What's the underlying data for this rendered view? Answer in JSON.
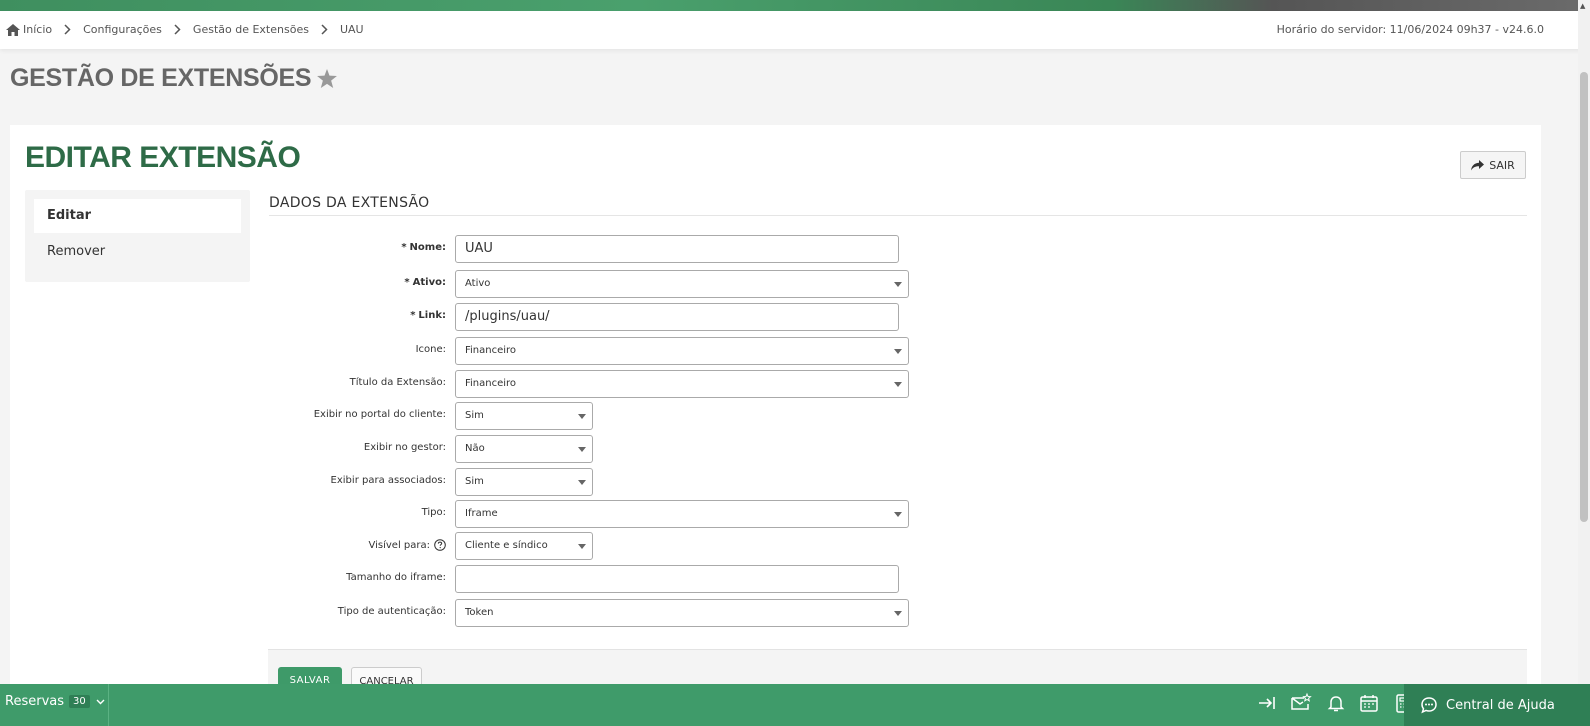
{
  "breadcrumb": [
    "Início",
    "Configurações",
    "Gestão de Extensões",
    "UAU"
  ],
  "server_time": "Horário do servidor: 11/06/2024 09h37 - v24.6.0",
  "page_title": "GESTÃO DE EXTENSÕES",
  "card": {
    "title": "EDITAR EXTENSÃO",
    "exit_label": "SAIR"
  },
  "side_menu": {
    "edit": "Editar",
    "remove": "Remover"
  },
  "section_title": "DADOS DA EXTENSÃO",
  "form": {
    "nome": {
      "label": "Nome:",
      "required": "*",
      "value": "UAU"
    },
    "ativo": {
      "label": "Ativo:",
      "required": "*",
      "value": "Ativo"
    },
    "link": {
      "label": "Link:",
      "required": "*",
      "value": "/plugins/uau/"
    },
    "icone": {
      "label": "Icone:",
      "value": "Financeiro"
    },
    "titulo": {
      "label": "Título da Extensão:",
      "value": "Financeiro"
    },
    "portal_cliente": {
      "label": "Exibir no portal do cliente:",
      "value": "Sim"
    },
    "gestor": {
      "label": "Exibir no gestor:",
      "value": "Não"
    },
    "associados": {
      "label": "Exibir para associados:",
      "value": "Sim"
    },
    "tipo": {
      "label": "Tipo:",
      "value": "Iframe"
    },
    "visivel": {
      "label": "Visível para:",
      "value": "Cliente e síndico"
    },
    "tamanho_iframe": {
      "label": "Tamanho do iframe:",
      "value": ""
    },
    "autenticacao": {
      "label": "Tipo de autenticação:",
      "value": "Token"
    }
  },
  "buttons": {
    "save": "SALVAR",
    "cancel": "CANCELAR"
  },
  "bottombar": {
    "reservas_label": "Reservas",
    "reservas_count": "30",
    "help_center": "Central de Ajuda"
  },
  "colors": {
    "brand_green": "#3f9b6a",
    "title_green": "#2e6b47"
  }
}
